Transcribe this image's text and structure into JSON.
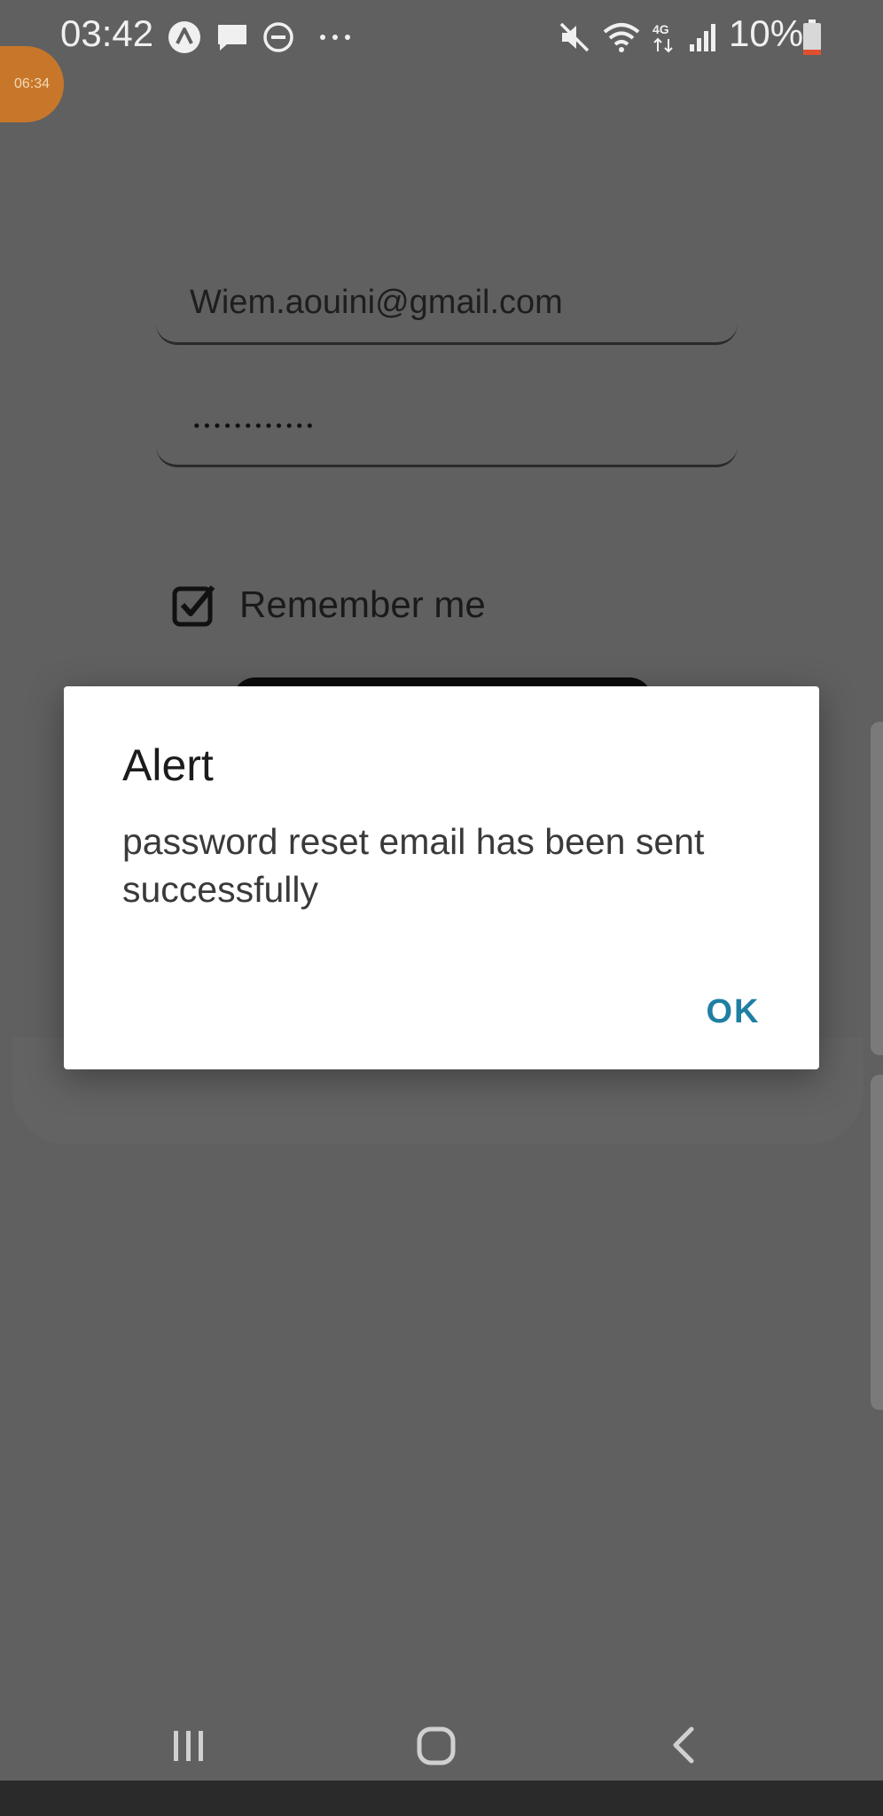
{
  "status_bar": {
    "time": "03:42",
    "battery": "10%",
    "icons": [
      "a-badge-icon",
      "message-icon",
      "dnd-icon",
      "more-dots-icon",
      "mute-icon",
      "wifi-icon",
      "lte-4g-icon",
      "signal-icon",
      "battery-icon"
    ]
  },
  "recording_bubble": {
    "time": "06:34"
  },
  "login_form": {
    "email_value": "Wiem.aouini@gmail.com",
    "remember_checked": true,
    "remember_label": "Remember me"
  },
  "dialog": {
    "title": "Alert",
    "message": "password reset email has been sent successfully",
    "ok_label": "OK",
    "ok_color": "#1f7fa3"
  },
  "nav_bar": {
    "icons": [
      "recent-apps-icon",
      "home-icon",
      "back-icon"
    ]
  },
  "colors": {
    "scrim": "#606060",
    "dialog": "#ffffff"
  }
}
